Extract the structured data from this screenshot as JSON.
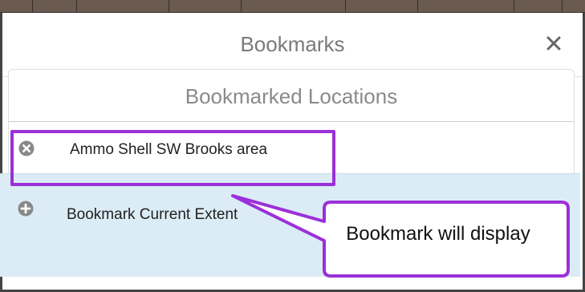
{
  "dialog": {
    "title": "Bookmarks",
    "close_symbol": "×"
  },
  "panel": {
    "title": "Bookmarked Locations"
  },
  "bookmarks": [
    {
      "label": "Ammo Shell SW Brooks area",
      "icon": "remove-circle-icon"
    }
  ],
  "add_bookmark": {
    "label": "Bookmark Current Extent",
    "icon": "add-circle-icon"
  },
  "annotation": {
    "text": "Bookmark will display",
    "accent_color": "#9b30d9"
  },
  "colors": {
    "selected_row_bg": "#dcecf6",
    "icon_gray": "#888888"
  }
}
